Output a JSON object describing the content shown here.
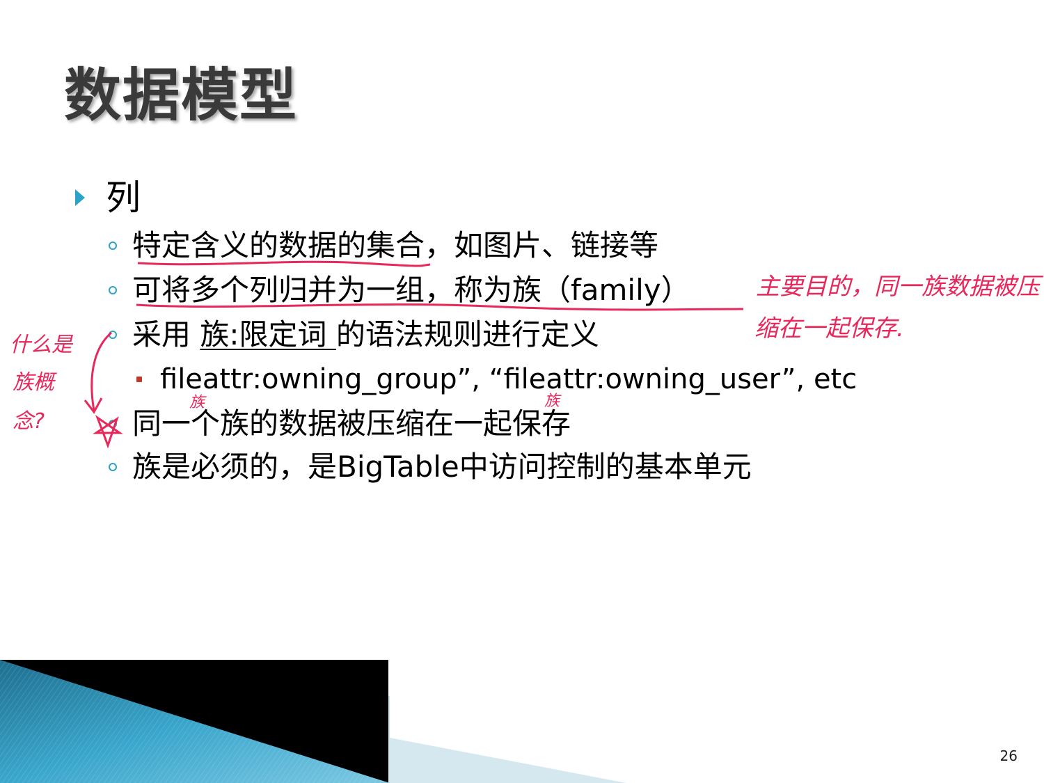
{
  "slide": {
    "title": "数据模型",
    "bullet_l1": "列",
    "bullets": [
      "特定含义的数据的集合，如图片、链接等",
      "可将多个列归并为一组，称为族（family）",
      "采用 族:限定词 的语法规则进行定义",
      "同一个族的数据被压缩在一起保存",
      "族是必须的，是BigTable中访问控制的基本单元"
    ],
    "bullet_3_parts": {
      "before": "采用 ",
      "underlined": "族:限定词 ",
      "after": "的语法规则进行定义"
    },
    "sub_bullet": "fileattr:owning_group”, “fileattr:owning_user”, etc",
    "page_number": "26"
  },
  "annotations": {
    "note_right_line1": "主要目的，同一族数据被压",
    "note_right_line2": "缩在一起保存.",
    "note_left_line1": "什么是",
    "note_left_line2": "族概",
    "note_left_line3": "念?",
    "note_small_1": "族",
    "note_small_2": "族"
  },
  "colors": {
    "accent": "#2aa3c7",
    "ink": "#e8275a",
    "title": "#3a3a3a"
  }
}
